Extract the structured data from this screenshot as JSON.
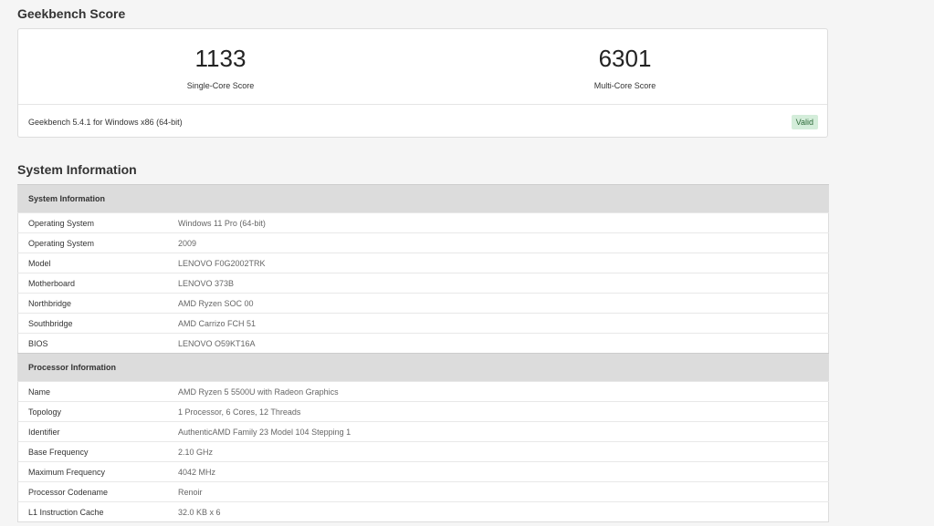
{
  "score_section": {
    "title": "Geekbench Score",
    "single_core": {
      "value": "1133",
      "label": "Single-Core Score"
    },
    "multi_core": {
      "value": "6301",
      "label": "Multi-Core Score"
    },
    "version_text": "Geekbench 5.4.1 for Windows x86 (64-bit)",
    "status": "Valid"
  },
  "system_section": {
    "title": "System Information",
    "groups": [
      {
        "header": "System Information",
        "rows": [
          {
            "key": "Operating System",
            "value": "Windows 11 Pro (64-bit)"
          },
          {
            "key": "Operating System",
            "value": "2009"
          },
          {
            "key": "Model",
            "value": "LENOVO F0G2002TRK"
          },
          {
            "key": "Motherboard",
            "value": "LENOVO 373B"
          },
          {
            "key": "Northbridge",
            "value": "AMD Ryzen SOC 00"
          },
          {
            "key": "Southbridge",
            "value": "AMD Carrizo FCH 51"
          },
          {
            "key": "BIOS",
            "value": "LENOVO O59KT16A"
          }
        ]
      },
      {
        "header": "Processor Information",
        "rows": [
          {
            "key": "Name",
            "value": "AMD Ryzen 5 5500U with Radeon Graphics"
          },
          {
            "key": "Topology",
            "value": "1 Processor, 6 Cores, 12 Threads"
          },
          {
            "key": "Identifier",
            "value": "AuthenticAMD Family 23 Model 104 Stepping 1"
          },
          {
            "key": "Base Frequency",
            "value": "2.10 GHz"
          },
          {
            "key": "Maximum Frequency",
            "value": "4042 MHz"
          },
          {
            "key": "Processor Codename",
            "value": "Renoir"
          },
          {
            "key": "L1 Instruction Cache",
            "value": "32.0 KB x 6"
          }
        ]
      }
    ]
  }
}
